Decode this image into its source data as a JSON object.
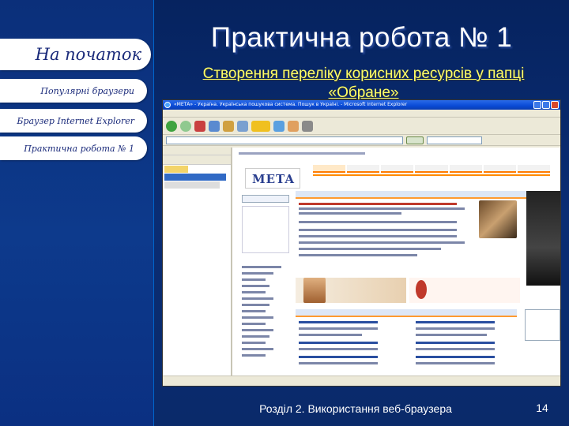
{
  "nav": {
    "home": "На початок",
    "browsers": "Популярні браузери",
    "ie": "Браузер Internet Explorer",
    "practice": "Практична робота № 1"
  },
  "slide": {
    "title": "Практична робота № 1",
    "subtitle": "Створення переліку корисних ресурсів у папці «Обране»"
  },
  "browser_window": {
    "title": "«МЕТА» - Україна. Українська пошукова система. Пошук в Україні. - Microsoft Internet Explorer",
    "site_logo": "META"
  },
  "footer": {
    "section": "Розділ 2. Використання веб-браузера",
    "page_number": "14"
  },
  "colors": {
    "background": "#0a2a6e",
    "nav_button": "#ffffff",
    "nav_text": "#1a2a7a",
    "title_text": "#ffffff",
    "subtitle_text": "#ffff66"
  }
}
